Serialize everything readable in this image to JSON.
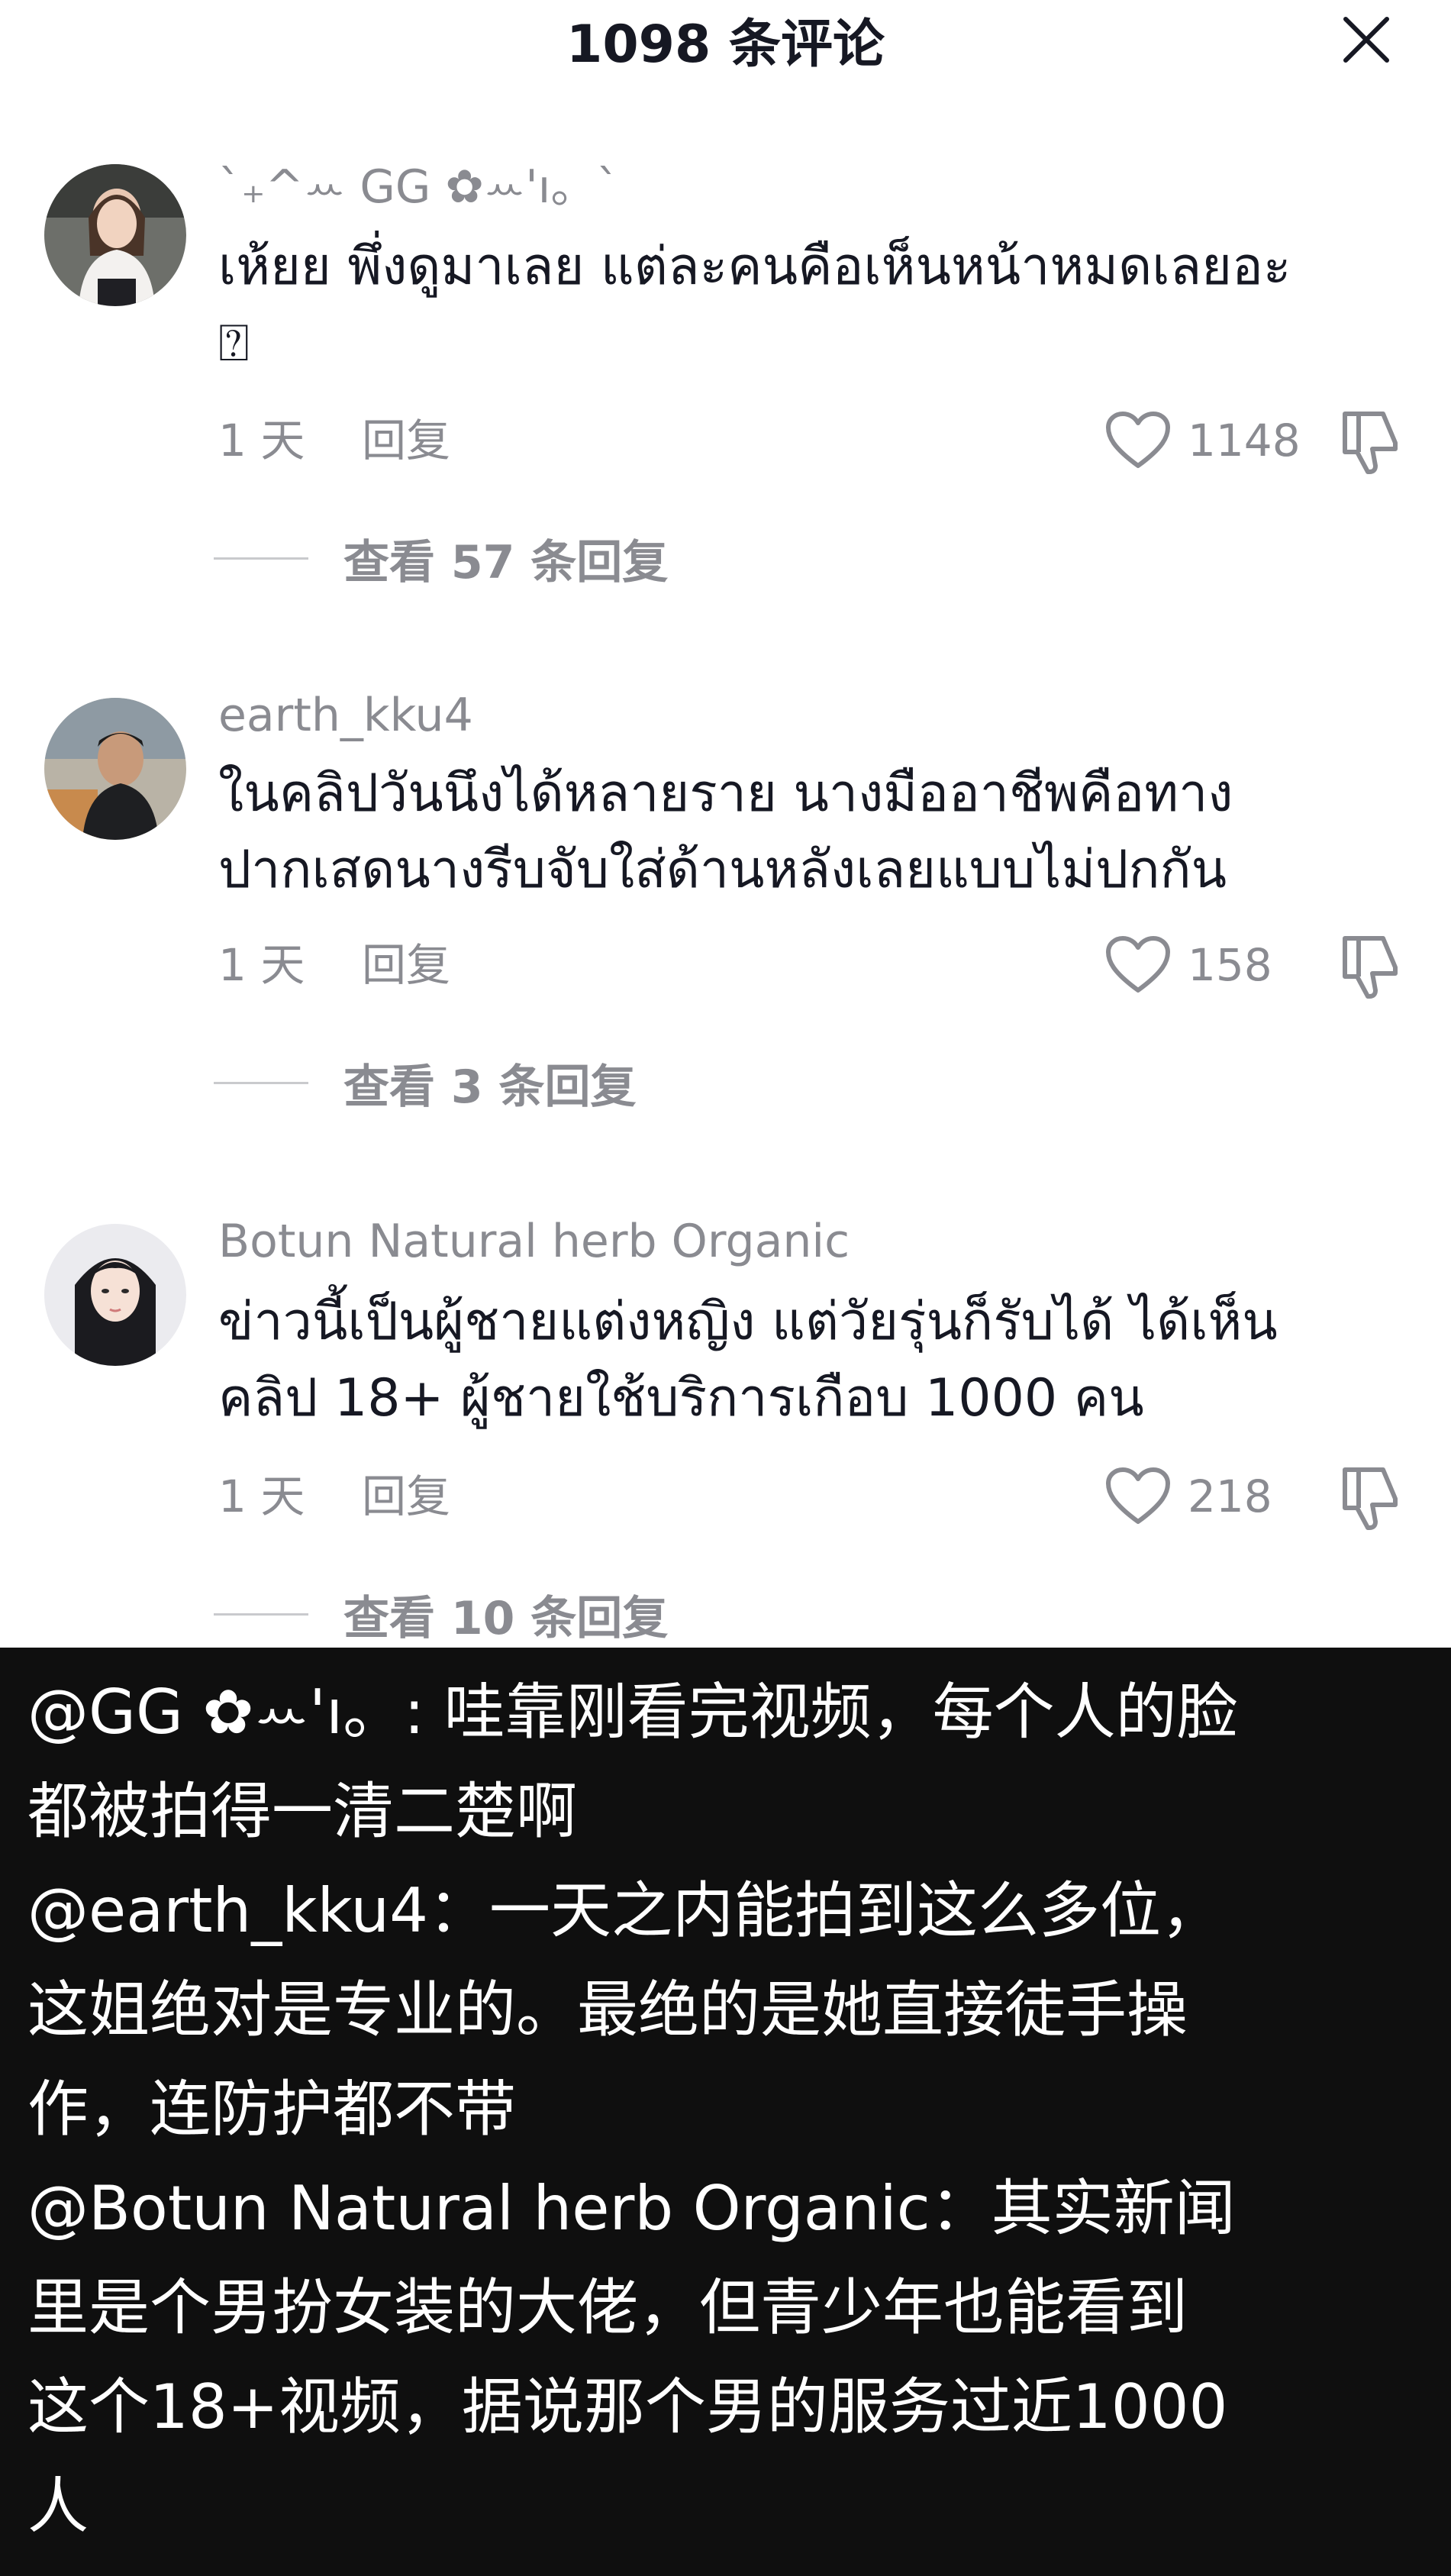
{
  "header": {
    "title": "1098 条评论",
    "close_icon": "close-icon"
  },
  "comments": [
    {
      "username": "ˋ₊^ꕀ GG ✿ꕀ'ı。ˋ",
      "text": "เห้ยย พึ่งดูมาเลย แต่ละคนคือเห็นหน้าหมดเลยอะ",
      "text_line2": "⍰",
      "time": "1 天",
      "reply_label": "回复",
      "likes": "1148",
      "view_replies": "查看 57 条回复"
    },
    {
      "username": "earth_kku4",
      "text": "ในคลิปวันนึงได้หลายราย นางมืออาชีพคือทาง",
      "text_line2": "ปากเสดนางรีบจับใส่ด้านหลังเลยแบบไม่ปกกัน",
      "time": "1 天",
      "reply_label": "回复",
      "likes": "158",
      "view_replies": "查看 3 条回复"
    },
    {
      "username": "Botun Natural herb Organic",
      "text": "ข่าวนี้เป็นผู้ชายแต่งหญิง แต่วัยรุ่นก็รับได้ ได้เห็น",
      "text_line2": "คลิป 18+ ผู้ชายใช้บริการเกือบ 1000 คน",
      "time": "1 天",
      "reply_label": "回复",
      "likes": "218",
      "view_replies": "查看 10 条回复"
    }
  ],
  "caption": {
    "lines": [
      "@GG ✿ꕀ'ı。:   哇靠刚看完视频，每个人的脸",
      "都被拍得一清二楚啊",
      "@earth_kku4：一天之内能拍到这么多位，",
      "这姐绝对是专业的。最绝的是她直接徒手操",
      "作，连防护都不带",
      "@Botun Natural herb Organic：其实新闻",
      "里是个男扮女装的大佬，但青少年也能看到",
      "这个18+视频，据说那个男的服务过近1000",
      "人"
    ]
  },
  "colors": {
    "text_primary": "#161823",
    "text_secondary": "#8a8b91",
    "caption_bg": "#0f0f0f",
    "caption_text": "#ffffff"
  },
  "icons": {
    "like": "heart-outline-icon",
    "dislike": "thumbs-down-icon"
  }
}
